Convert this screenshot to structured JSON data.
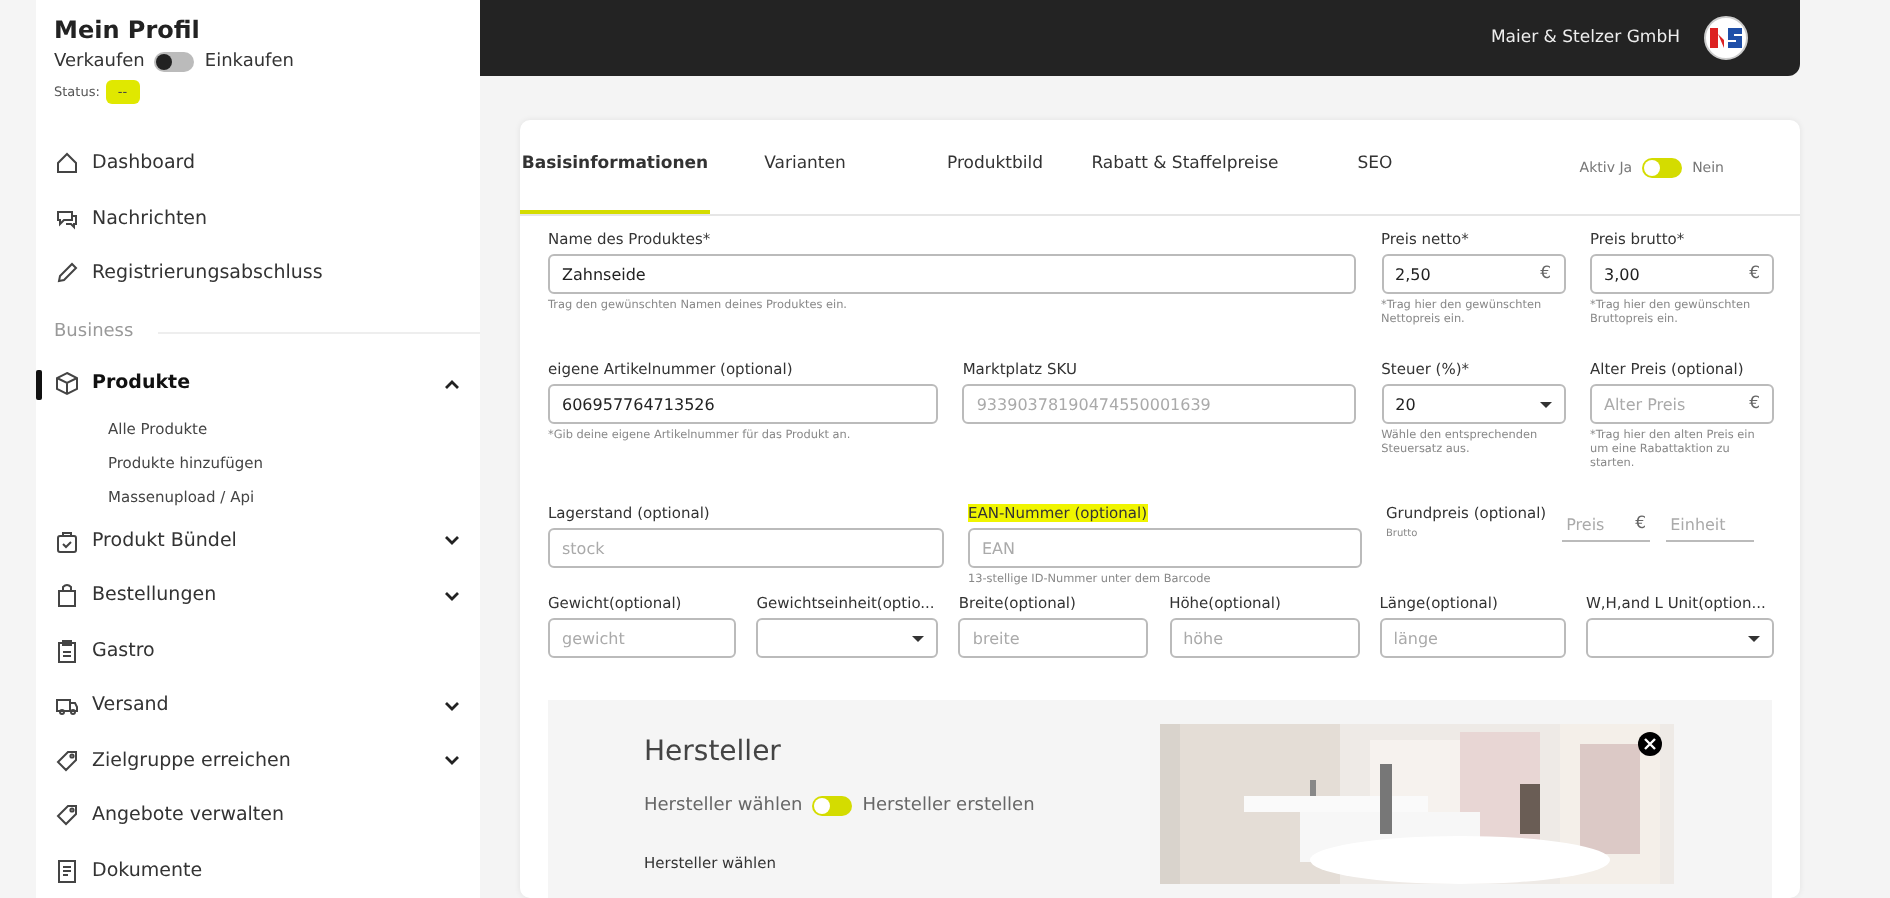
{
  "sidebar": {
    "title": "Mein Profil",
    "mode_toggle": {
      "left_label": "Verkaufen",
      "right_label": "Einkaufen",
      "kind": "plain",
      "on": false
    },
    "status": {
      "label": "Status:",
      "value": "--"
    },
    "nav": [
      {
        "kind": "link",
        "label": "Dashboard",
        "selected": false
      },
      {
        "kind": "link",
        "label": "Nachrichten",
        "selected": false
      },
      {
        "kind": "link",
        "label": "Registrierungsabschluss",
        "selected": false
      },
      {
        "kind": "section",
        "label": "Business"
      },
      {
        "kind": "link",
        "label": "Produkte",
        "selected": true,
        "expanded": true,
        "children": [
          {
            "label": "Alle Produkte"
          },
          {
            "label": "Produkte hinzufügen"
          },
          {
            "label": "Massenupload / Api"
          }
        ]
      },
      {
        "kind": "link",
        "label": "Produkt Bündel",
        "selected": false,
        "expanded": false
      },
      {
        "kind": "link",
        "label": "Bestellungen",
        "selected": false,
        "expanded": false
      },
      {
        "kind": "link",
        "label": "Gastro",
        "selected": false
      },
      {
        "kind": "link",
        "label": "Versand",
        "selected": false,
        "expanded": false
      },
      {
        "kind": "link",
        "label": "Zielgruppe erreichen",
        "selected": false,
        "expanded": false
      },
      {
        "kind": "link",
        "label": "Angebote verwalten",
        "selected": false
      },
      {
        "kind": "link",
        "label": "Dokumente",
        "selected": false
      }
    ]
  },
  "topbar": {
    "company": "Maier & Stelzer GmbH"
  },
  "tabs": [
    {
      "label": "Basisinformationen",
      "selected": true
    },
    {
      "label": "Varianten",
      "selected": false
    },
    {
      "label": "Produktbild",
      "selected": false
    },
    {
      "label": "Rabatt & Staffelpreise",
      "selected": false
    },
    {
      "label": "SEO",
      "selected": false
    }
  ],
  "active_toggle": {
    "left_label": "Aktiv Ja",
    "right_label": "Nein",
    "kind": "accent",
    "on": false
  },
  "form_rows": [
    [
      {
        "kind": "text",
        "label": "Name des Produktes*",
        "value": "Zahnseide",
        "hint": "Trag den gewünschten Namen deines Produktes ein."
      },
      {
        "kind": "price",
        "label": "Preis netto*",
        "value": "2,50",
        "suffix": "€",
        "hint": "*Trag hier den gewünschten Nettopreis ein."
      },
      {
        "kind": "price",
        "label": "Preis brutto*",
        "value": "3,00",
        "suffix": "€",
        "hint": "*Trag hier den gewünschten Bruttopreis ein."
      }
    ],
    [
      {
        "kind": "text",
        "label": "eigene Artikelnummer (optional)",
        "value": "606957764713526",
        "hint": "*Gib deine eigene Artikelnummer für das Produkt an."
      },
      {
        "kind": "text",
        "label": "Marktplatz SKU",
        "placeholder": "93390378190474550001639"
      },
      {
        "kind": "select",
        "label": "Steuer (%)*",
        "value": "20",
        "hint": "Wähle den entsprechenden Steuersatz aus."
      },
      {
        "kind": "price",
        "label": "Alter Preis (optional)",
        "placeholder": "Alter Preis",
        "suffix": "€",
        "hint": "*Trag hier den alten Preis ein um eine Rabattaktion zu starten."
      }
    ],
    [
      {
        "kind": "text",
        "label": "Lagerstand (optional)",
        "placeholder": "stock"
      },
      {
        "kind": "text",
        "label": "EAN-Nummer (optional)",
        "highlighted": true,
        "placeholder": "EAN",
        "hint": "13-stellige ID-Nummer unter dem Barcode"
      },
      {
        "kind": "grundpreis",
        "label": "Grundpreis (optional)",
        "sublabel": "Brutto",
        "price_placeholder": "Preis",
        "suffix": "€",
        "unit_placeholder": "Einheit"
      }
    ],
    [
      {
        "kind": "text",
        "label": "Gewicht(optional)",
        "placeholder": "gewicht"
      },
      {
        "kind": "select",
        "label": "Gewichtseinheit(optio..."
      },
      {
        "kind": "text",
        "label": "Breite(optional)",
        "placeholder": "breite"
      },
      {
        "kind": "text",
        "label": "Höhe(optional)",
        "placeholder": "höhe"
      },
      {
        "kind": "text",
        "label": "Länge(optional)",
        "placeholder": "länge"
      },
      {
        "kind": "select",
        "label": "W,H,and L Unit(option..."
      }
    ]
  ],
  "manufacturer": {
    "title": "Hersteller",
    "toggle": {
      "left_label": "Hersteller wählen",
      "right_label": "Hersteller erstellen",
      "kind": "accent",
      "on": false
    },
    "field_label": "Hersteller wählen"
  }
}
